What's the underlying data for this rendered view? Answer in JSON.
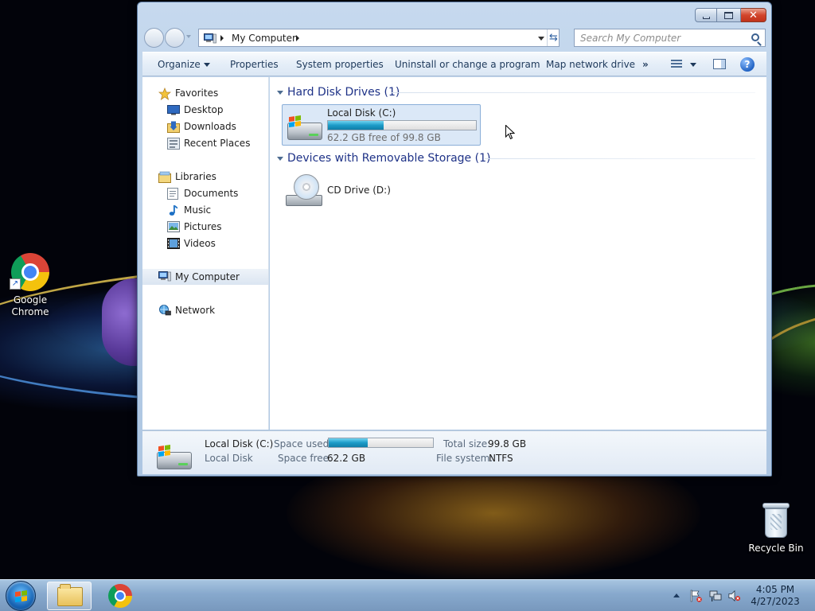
{
  "desktop": {
    "icons": [
      {
        "label": "Google Chrome"
      },
      {
        "label": "Recycle Bin"
      }
    ]
  },
  "window": {
    "address": {
      "crumb": "My Computer"
    },
    "search": {
      "placeholder": "Search My Computer"
    },
    "toolbar": {
      "organize": "Organize",
      "properties": "Properties",
      "system_properties": "System properties",
      "uninstall": "Uninstall or change a program",
      "map_drive": "Map network drive",
      "more": "»",
      "help": "?"
    },
    "nav": {
      "favorites": "Favorites",
      "desktop": "Desktop",
      "downloads": "Downloads",
      "recent_places": "Recent Places",
      "libraries": "Libraries",
      "documents": "Documents",
      "music": "Music",
      "pictures": "Pictures",
      "videos": "Videos",
      "my_computer": "My Computer",
      "network": "Network"
    },
    "groups": {
      "hard_disks": {
        "title": "Hard Disk Drives (1)",
        "drive": {
          "name": "Local Disk (C:)",
          "space_text": "62.2 GB free of 99.8 GB",
          "used_fraction": 0.377
        }
      },
      "removable": {
        "title": "Devices with Removable Storage (1)",
        "drive": {
          "name": "CD Drive (D:)"
        }
      }
    },
    "details": {
      "name": "Local Disk (C:)",
      "type": "Local Disk",
      "space_used_label": "Space used:",
      "space_free_label": "Space free:",
      "space_free_value": "62.2 GB",
      "total_size_label": "Total size:",
      "total_size_value": "99.8 GB",
      "file_system_label": "File system:",
      "file_system_value": "NTFS",
      "used_fraction": 0.377
    }
  },
  "taskbar": {
    "clock": {
      "time": "4:05 PM",
      "date": "4/27/2023"
    }
  }
}
